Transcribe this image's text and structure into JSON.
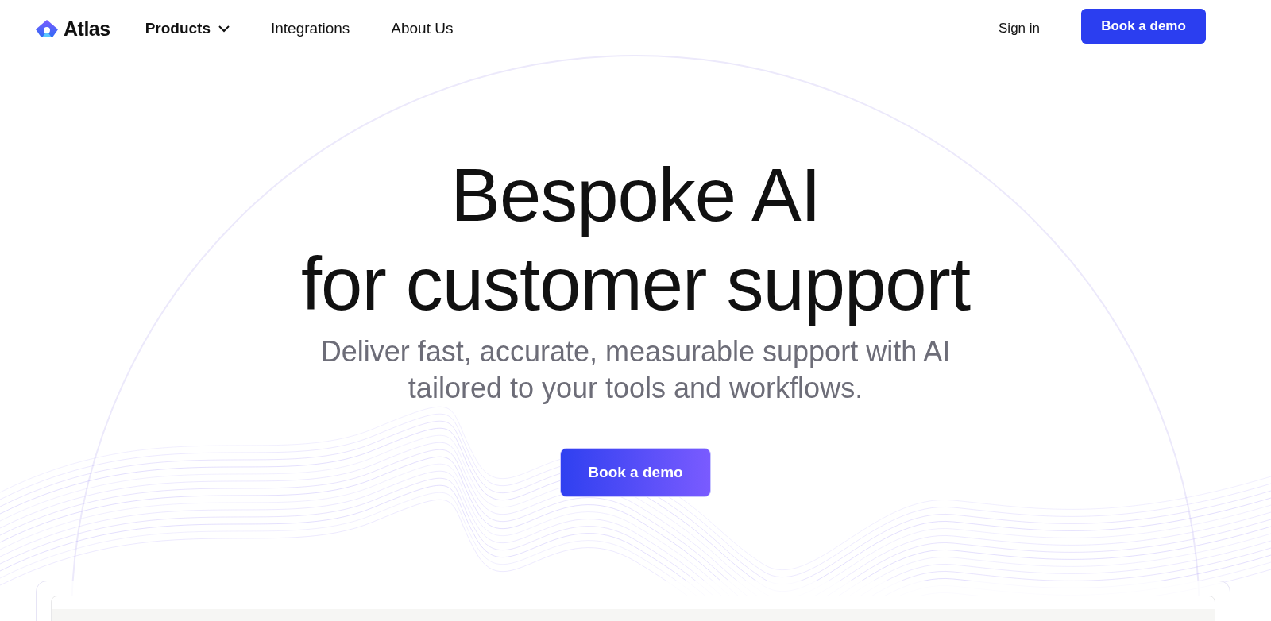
{
  "nav": {
    "logo": "Atlas",
    "links": [
      {
        "label": "Products",
        "kind": "dropdown"
      },
      {
        "label": "Integrations",
        "kind": "link"
      },
      {
        "label": "About Us",
        "kind": "link"
      }
    ],
    "sign_in": "Sign in",
    "cta": "Book a demo"
  },
  "hero": {
    "title_lines": [
      "Bespoke AI",
      "for customer support"
    ],
    "subtitle": "Deliver fast, accurate, measurable support with AI tailored to your tools and workflows.",
    "cta": "Book a demo"
  }
}
